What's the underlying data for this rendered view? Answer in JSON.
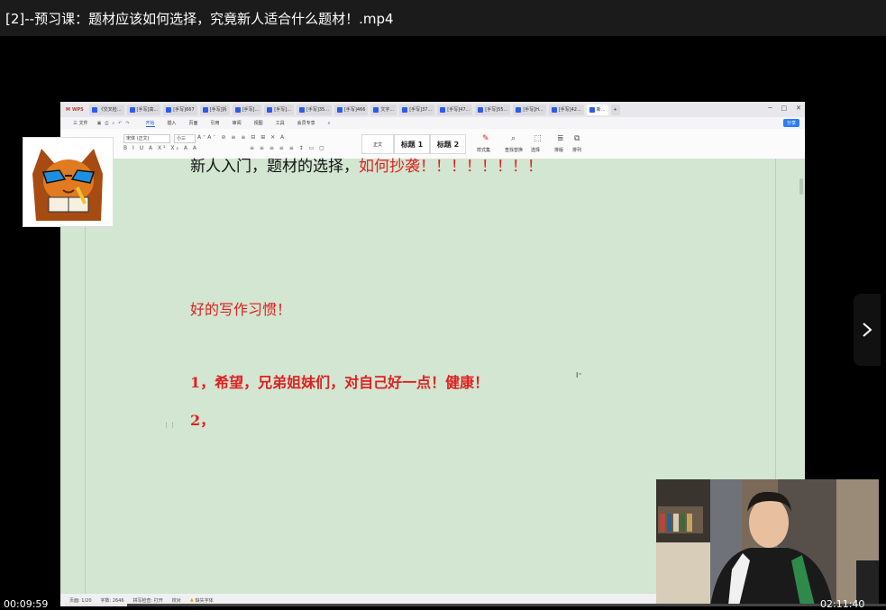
{
  "player": {
    "title": "[2]--预习课：题材应该如何选择，究竟新人适合什么题材！.mp4",
    "time_current": "00:09:59",
    "time_total": "02:11:40",
    "progress_fraction": 0.076
  },
  "wps": {
    "brand": "WPS",
    "tabs": [
      "《交叉检...",
      "[手写]高...",
      "[手写]667",
      "[手写]拆",
      "[手写]...",
      "[手写]...",
      "[手写]35...",
      "[手写]466",
      "文字...",
      "[手写]37...",
      "[手写]47...",
      "[手写]55...",
      "[手写]H...",
      "[手写]42...",
      "新..."
    ],
    "menu": [
      "三 文件",
      "开始",
      "插入",
      "页面",
      "引用",
      "审阅",
      "视图",
      "工具",
      "会员专享"
    ],
    "active_menu": "开始",
    "share_label": "分享",
    "font_name": "宋体 (正文)",
    "font_size": "小三",
    "styles": [
      "正文",
      "标题 1",
      "标题 2"
    ],
    "tools": [
      "样式集",
      "查找替换",
      "选择",
      "排版",
      "排列"
    ]
  },
  "document": {
    "line1_black": "新人入门，题材的选择，",
    "line1_red": "如何抄袭！！！！！！！！",
    "line2": "好的写作习惯！",
    "line3": "1，希望，兄弟姐妹们，对自己好一点！健康！",
    "line4": "2，"
  },
  "status": {
    "page": "页面: 1/20",
    "words": "字数: 2646",
    "spell": "拼写检查: 打开",
    "proof": "校对",
    "font_missing": "缺失字体"
  },
  "colors": {
    "accent": "#2b5ce6",
    "doc_red": "#e02020",
    "page_bg": "#d2e6d1"
  }
}
